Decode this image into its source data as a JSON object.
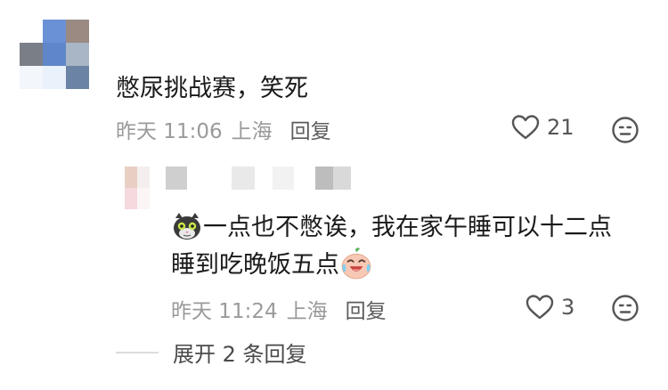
{
  "main_comment": {
    "text": "憋尿挑战赛，笑死",
    "time": "昨天 11:06",
    "location": "上海",
    "reply_label": "回复",
    "like_count": "21",
    "like_icon": "heart-outline-icon",
    "dislike_icon": "meh-face-icon"
  },
  "reply_comment": {
    "emoji_start": "cat-face-emoji",
    "line1": "一点也不憋诶，我在家午睡可以十二点",
    "line2": "睡到吃晚饭五点",
    "emoji_end": "crying-laughing-emoji",
    "time": "昨天 11:24",
    "location": "上海",
    "reply_label": "回复",
    "like_count": "3",
    "like_icon": "heart-outline-icon",
    "dislike_icon": "meh-face-icon"
  },
  "expand": {
    "label": "展开 2 条回复"
  },
  "colors": {
    "text": "#1a1a1a",
    "meta": "#9a9a9a",
    "icon": "#555555"
  }
}
